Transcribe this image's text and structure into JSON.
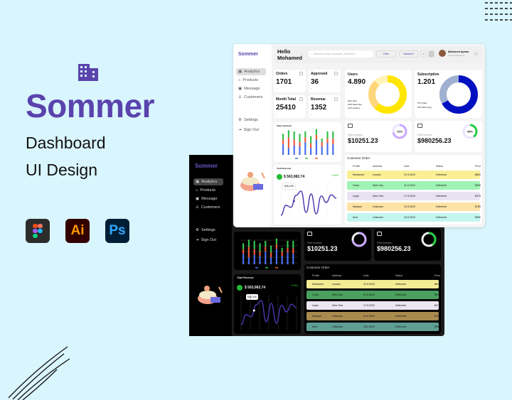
{
  "promo": {
    "brand": "Sommer",
    "subtitle_line1": "Dashboard",
    "subtitle_line2": "UI Design",
    "tools": [
      {
        "name": "figma",
        "label": ""
      },
      {
        "name": "illustrator",
        "label": "Ai",
        "bg": "#330000",
        "fg": "#ff9a00"
      },
      {
        "name": "photoshop",
        "label": "Ps",
        "bg": "#001e36",
        "fg": "#31a8ff"
      }
    ]
  },
  "colors": {
    "brand": "#5a43ad",
    "background": "#d9f5fd",
    "yellow": "#ffe600",
    "navy": "#0010c0",
    "purple_ring": "#c9a8ff",
    "green_ring": "#22cc44",
    "bar_blue": "#4a6ef0",
    "bar_red": "#f05a3a",
    "bar_green": "#33c24d",
    "line": "#4a35b0"
  },
  "sidebar": {
    "logo": "Sommer",
    "items": [
      {
        "label": "Analytics",
        "icon": "grid-icon",
        "active": true
      },
      {
        "label": "Products",
        "icon": "bag-icon"
      },
      {
        "label": "Message",
        "icon": "chat-icon"
      },
      {
        "label": "Customers",
        "icon": "user-icon"
      }
    ],
    "settings": "Settings",
    "signout": "Sign Out"
  },
  "header": {
    "greeting_line1": "Hello",
    "greeting_line2": "Mohamed",
    "search_placeholder": "Search for task, employee, document...",
    "filter": "Filter",
    "sort": "Newest",
    "user_name": "Mohamed Ayman",
    "user_role": "Account Manager"
  },
  "stats": [
    {
      "label": "Orders",
      "value": "1701",
      "trend": "up"
    },
    {
      "label": "Approved",
      "value": "36",
      "trend": "up"
    },
    {
      "label": "Month Total",
      "value": "25410",
      "trend": "down"
    },
    {
      "label": "Revenue",
      "value": "1352",
      "trend": "down"
    }
  ],
  "users": {
    "label": "Users",
    "value": "4.890",
    "legend": [
      "62% New",
      "26% Returning",
      "12% Inactive"
    ],
    "slices": [
      62,
      26,
      12
    ]
  },
  "subscription": {
    "label": "Subscription",
    "value": "1.201",
    "legend": [
      "67% Paid",
      "33% Returning"
    ],
    "slices": [
      67,
      33
    ]
  },
  "invoices": [
    {
      "label": "Paid Invoices",
      "value": "$10251.23",
      "percent": "72%",
      "pct": 72
    },
    {
      "label": "Paid Invoices",
      "value": "$980256.23",
      "percent": "40%",
      "pct": 40
    }
  ],
  "sales": {
    "title": "Sales Dynamic",
    "bars": [
      [
        45,
        20,
        25
      ],
      [
        30,
        45,
        30
      ],
      [
        40,
        25,
        35
      ],
      [
        35,
        20,
        35
      ],
      [
        55,
        20,
        25
      ],
      [
        30,
        20,
        30
      ],
      [
        65,
        20,
        25
      ],
      [
        35,
        20,
        15
      ],
      [
        50,
        20,
        30
      ],
      [
        45,
        25,
        30
      ]
    ]
  },
  "revenue": {
    "title": "Total Revenue",
    "value": "$ 563,982.74",
    "change": "+9.8%",
    "tooltip_value": "$45,345",
    "line": [
      10,
      45,
      38,
      80,
      95,
      20,
      85,
      15,
      78,
      55,
      82,
      70
    ]
  },
  "orders": {
    "title": "Customer Order",
    "columns": [
      "Profile",
      "Address",
      "Date",
      "Status",
      "Price"
    ],
    "rows": [
      {
        "cells": [
          "Mohamed",
          "London",
          "22.5.2023",
          "Delivered",
          "$800"
        ],
        "light": "#fbef95",
        "dark": "#f6eb95"
      },
      {
        "cells": [
          "Omar",
          "Main City",
          "11.5.2023",
          "Delivered",
          "$405"
        ],
        "light": "#9ff3b5",
        "dark": "#4aa05e"
      },
      {
        "cells": [
          "Layla",
          "New York",
          "17.5.2023",
          "Delivered",
          "$475"
        ],
        "light": "#e9e2f2",
        "dark": "#ece6f2"
      },
      {
        "cells": [
          "Maryam",
          "Unknown",
          "10.5.2023",
          "Delivered",
          "$789"
        ],
        "light": "#fde3a4",
        "dark": "#a98b4f"
      },
      {
        "cells": [
          "Amir",
          "Unknown",
          "15.5.2023",
          "Delivered",
          "$980"
        ],
        "light": "#c2f6ee",
        "dark": "#5f9f93"
      }
    ]
  }
}
